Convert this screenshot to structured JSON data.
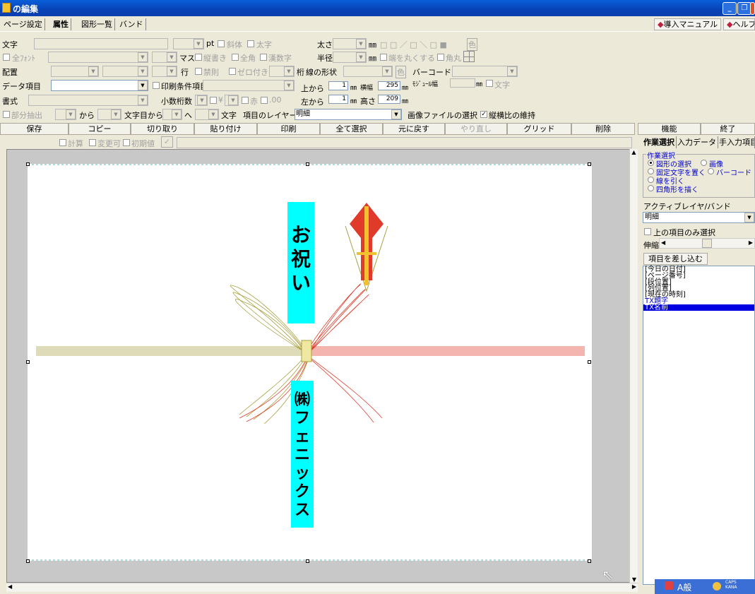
{
  "window": {
    "title": "の編集",
    "min": "_",
    "max": "❐",
    "close": "X"
  },
  "menu": {
    "tabs": [
      "ページ設定",
      "属性",
      "図形一覧",
      "バンド"
    ],
    "manual": "導入マニュアル",
    "help": "ヘルプ"
  },
  "props": {
    "moji": "文字",
    "pt": "pt",
    "shatai": "斜体",
    "futoji": "太字",
    "futosa": "太さ",
    "mm": "㎜",
    "iro": "色",
    "zenfont": "全ﾌｫﾝﾄ",
    "masu": "マス",
    "tategaki": "縦書き",
    "zenkaku": "全角",
    "kansuji": "漢数字",
    "hankei": "半径",
    "hashi": "端を丸くする",
    "kadomaru": "角丸",
    "haichi": "配置",
    "gyo": "行",
    "kinsoku": "禁則",
    "zero": "ゼロ付き",
    "keta": "桁",
    "senkei": "線の形状",
    "barcode": "バーコード",
    "datakoumoku": "データ項目",
    "insatsu": "印刷条件項目",
    "ue": "上から",
    "ue_val": "1",
    "yoko": "横幅",
    "yoko_val": "295",
    "module": "ﾓｼﾞｭｰﾙ幅",
    "mojiku": "文字",
    "shoshiki": "書式",
    "shosu": "小数桁数",
    "yen": "¥",
    "aka": "赤",
    "ten00": ".00",
    "hidari": "左から",
    "hidari_val": "1",
    "takasa": "高さ",
    "takasa_val": "209",
    "bubun": "部分抽出",
    "kara": "から",
    "mojime": "文字目から",
    "he": "へ",
    "mojiend": "文字",
    "layer_label": "項目のレイヤー",
    "layer_value": "明細",
    "gazo": "画像ファイルの選択",
    "aspect": "縦横比の維持"
  },
  "buttons": [
    "保存",
    "コピー",
    "切り取り",
    "貼り付け",
    "印刷",
    "全て選択",
    "元に戻す",
    "やり直し",
    "グリッド",
    "削除"
  ],
  "func_buttons": [
    "機能",
    "終了"
  ],
  "subbar": {
    "keisan": "計算",
    "henkou": "変更可",
    "shoki": "初期値"
  },
  "paper": {
    "top_text": [
      "お",
      "祝",
      "い"
    ],
    "bottom_text": [
      "㈱",
      "フ",
      "ェ",
      "ニ",
      "ッ",
      "ク",
      "ス"
    ],
    "cyan": "#00ffff",
    "red": "#e03a2a",
    "gold": "#a8a040"
  },
  "right": {
    "tabs": [
      "作業選択",
      "入力データ",
      "手入力項目"
    ],
    "group_title": "作業選択",
    "options": [
      {
        "label": "図形の選択",
        "checked": true
      },
      {
        "label": "画像",
        "checked": false
      },
      {
        "label": "固定文字を置く",
        "checked": false
      },
      {
        "label": "バーコード",
        "checked": false
      },
      {
        "label": "線を引く",
        "checked": false
      },
      {
        "label": "四角形を描く",
        "checked": false
      }
    ],
    "active_label": "アクティブレイヤ/バンド",
    "active_value": "明細",
    "only_above": "上の項目のみ選択",
    "zoom_label": "伸縮",
    "insert_btn": "項目を差し込む",
    "items": [
      "[今日の日付]",
      "[ページ番号]",
      "[段位置]",
      "[列位置]",
      "[現在の時刻]",
      "TX題字",
      "TX名前"
    ]
  },
  "taskbar": {
    "ime": "A般",
    "caps": "CAPS",
    "kana": "KANA"
  }
}
